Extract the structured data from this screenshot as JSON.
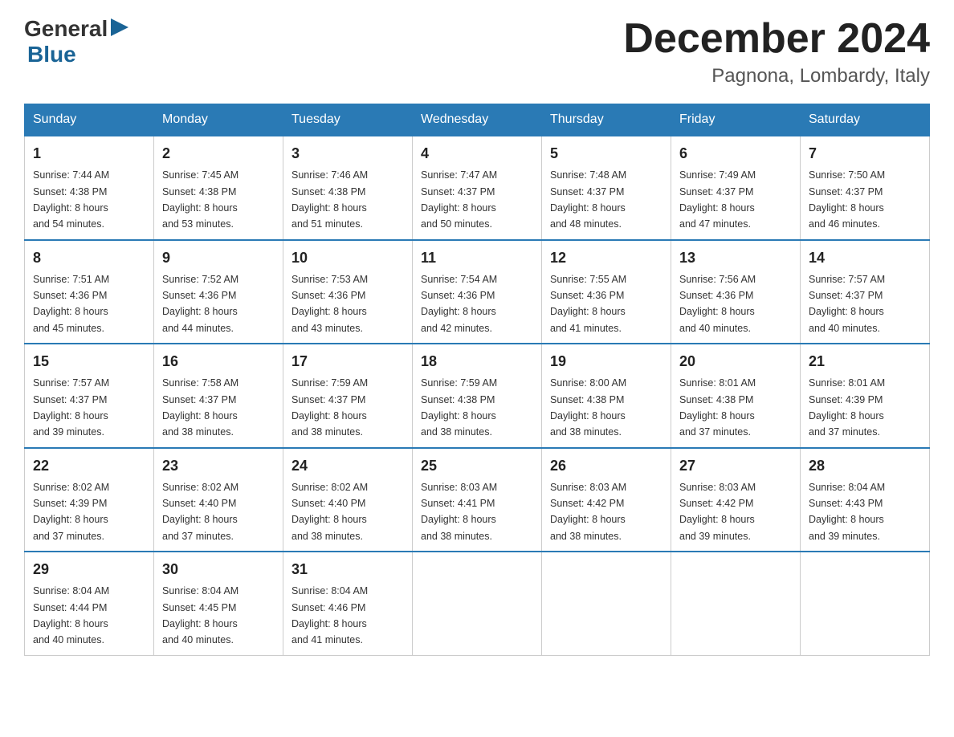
{
  "logo": {
    "general": "General",
    "blue": "Blue"
  },
  "title": "December 2024",
  "location": "Pagnona, Lombardy, Italy",
  "days_of_week": [
    "Sunday",
    "Monday",
    "Tuesday",
    "Wednesday",
    "Thursday",
    "Friday",
    "Saturday"
  ],
  "weeks": [
    [
      {
        "day": "1",
        "sunrise": "7:44 AM",
        "sunset": "4:38 PM",
        "daylight": "8 hours and 54 minutes."
      },
      {
        "day": "2",
        "sunrise": "7:45 AM",
        "sunset": "4:38 PM",
        "daylight": "8 hours and 53 minutes."
      },
      {
        "day": "3",
        "sunrise": "7:46 AM",
        "sunset": "4:38 PM",
        "daylight": "8 hours and 51 minutes."
      },
      {
        "day": "4",
        "sunrise": "7:47 AM",
        "sunset": "4:37 PM",
        "daylight": "8 hours and 50 minutes."
      },
      {
        "day": "5",
        "sunrise": "7:48 AM",
        "sunset": "4:37 PM",
        "daylight": "8 hours and 48 minutes."
      },
      {
        "day": "6",
        "sunrise": "7:49 AM",
        "sunset": "4:37 PM",
        "daylight": "8 hours and 47 minutes."
      },
      {
        "day": "7",
        "sunrise": "7:50 AM",
        "sunset": "4:37 PM",
        "daylight": "8 hours and 46 minutes."
      }
    ],
    [
      {
        "day": "8",
        "sunrise": "7:51 AM",
        "sunset": "4:36 PM",
        "daylight": "8 hours and 45 minutes."
      },
      {
        "day": "9",
        "sunrise": "7:52 AM",
        "sunset": "4:36 PM",
        "daylight": "8 hours and 44 minutes."
      },
      {
        "day": "10",
        "sunrise": "7:53 AM",
        "sunset": "4:36 PM",
        "daylight": "8 hours and 43 minutes."
      },
      {
        "day": "11",
        "sunrise": "7:54 AM",
        "sunset": "4:36 PM",
        "daylight": "8 hours and 42 minutes."
      },
      {
        "day": "12",
        "sunrise": "7:55 AM",
        "sunset": "4:36 PM",
        "daylight": "8 hours and 41 minutes."
      },
      {
        "day": "13",
        "sunrise": "7:56 AM",
        "sunset": "4:36 PM",
        "daylight": "8 hours and 40 minutes."
      },
      {
        "day": "14",
        "sunrise": "7:57 AM",
        "sunset": "4:37 PM",
        "daylight": "8 hours and 40 minutes."
      }
    ],
    [
      {
        "day": "15",
        "sunrise": "7:57 AM",
        "sunset": "4:37 PM",
        "daylight": "8 hours and 39 minutes."
      },
      {
        "day": "16",
        "sunrise": "7:58 AM",
        "sunset": "4:37 PM",
        "daylight": "8 hours and 38 minutes."
      },
      {
        "day": "17",
        "sunrise": "7:59 AM",
        "sunset": "4:37 PM",
        "daylight": "8 hours and 38 minutes."
      },
      {
        "day": "18",
        "sunrise": "7:59 AM",
        "sunset": "4:38 PM",
        "daylight": "8 hours and 38 minutes."
      },
      {
        "day": "19",
        "sunrise": "8:00 AM",
        "sunset": "4:38 PM",
        "daylight": "8 hours and 38 minutes."
      },
      {
        "day": "20",
        "sunrise": "8:01 AM",
        "sunset": "4:38 PM",
        "daylight": "8 hours and 37 minutes."
      },
      {
        "day": "21",
        "sunrise": "8:01 AM",
        "sunset": "4:39 PM",
        "daylight": "8 hours and 37 minutes."
      }
    ],
    [
      {
        "day": "22",
        "sunrise": "8:02 AM",
        "sunset": "4:39 PM",
        "daylight": "8 hours and 37 minutes."
      },
      {
        "day": "23",
        "sunrise": "8:02 AM",
        "sunset": "4:40 PM",
        "daylight": "8 hours and 37 minutes."
      },
      {
        "day": "24",
        "sunrise": "8:02 AM",
        "sunset": "4:40 PM",
        "daylight": "8 hours and 38 minutes."
      },
      {
        "day": "25",
        "sunrise": "8:03 AM",
        "sunset": "4:41 PM",
        "daylight": "8 hours and 38 minutes."
      },
      {
        "day": "26",
        "sunrise": "8:03 AM",
        "sunset": "4:42 PM",
        "daylight": "8 hours and 38 minutes."
      },
      {
        "day": "27",
        "sunrise": "8:03 AM",
        "sunset": "4:42 PM",
        "daylight": "8 hours and 39 minutes."
      },
      {
        "day": "28",
        "sunrise": "8:04 AM",
        "sunset": "4:43 PM",
        "daylight": "8 hours and 39 minutes."
      }
    ],
    [
      {
        "day": "29",
        "sunrise": "8:04 AM",
        "sunset": "4:44 PM",
        "daylight": "8 hours and 40 minutes."
      },
      {
        "day": "30",
        "sunrise": "8:04 AM",
        "sunset": "4:45 PM",
        "daylight": "8 hours and 40 minutes."
      },
      {
        "day": "31",
        "sunrise": "8:04 AM",
        "sunset": "4:46 PM",
        "daylight": "8 hours and 41 minutes."
      },
      null,
      null,
      null,
      null
    ]
  ],
  "labels": {
    "sunrise": "Sunrise:",
    "sunset": "Sunset:",
    "daylight": "Daylight:"
  }
}
